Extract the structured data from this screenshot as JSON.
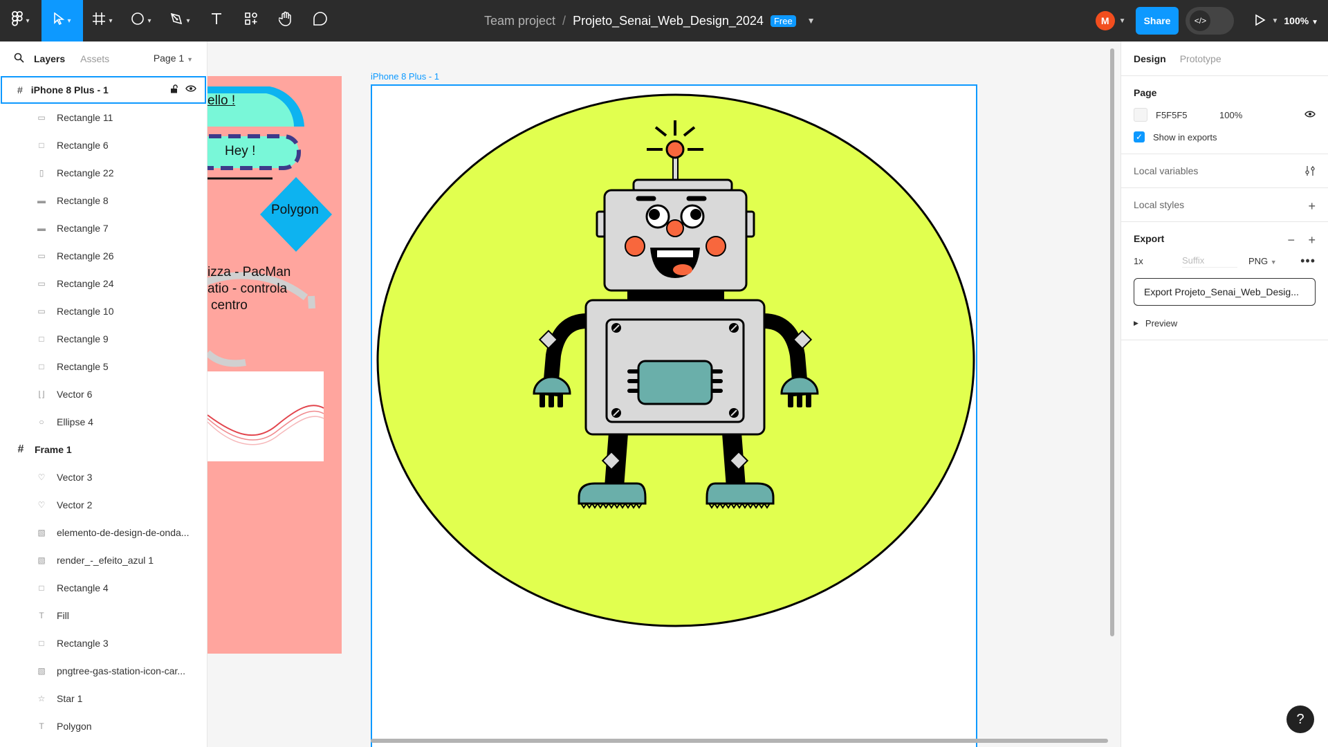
{
  "toolbar": {
    "team": "Team project",
    "file_name": "Projeto_Senai_Web_Design_2024",
    "plan_badge": "Free",
    "avatar_initial": "M",
    "share_label": "Share",
    "zoom": "100%"
  },
  "left_panel": {
    "tabs": [
      "Layers",
      "Assets"
    ],
    "page": "Page 1",
    "selected_frame": "iPhone 8 Plus - 1",
    "layers": [
      {
        "name": "Rectangle 11",
        "icon": "rect-icon"
      },
      {
        "name": "Rectangle 6",
        "icon": "rect-icon"
      },
      {
        "name": "Rectangle 22",
        "icon": "rect-icon"
      },
      {
        "name": "Rectangle 8",
        "icon": "rect-icon"
      },
      {
        "name": "Rectangle 7",
        "icon": "rect-icon"
      },
      {
        "name": "Rectangle 26",
        "icon": "rect-icon"
      },
      {
        "name": "Rectangle 24",
        "icon": "rect-icon"
      },
      {
        "name": "Rectangle 10",
        "icon": "rect-icon"
      },
      {
        "name": "Rectangle 9",
        "icon": "rect-icon"
      },
      {
        "name": "Rectangle 5",
        "icon": "rect-icon"
      },
      {
        "name": "Vector 6",
        "icon": "vector-icon"
      },
      {
        "name": "Ellipse 4",
        "icon": "ellipse-icon"
      }
    ],
    "frame2": "Frame 1",
    "frame2_layers": [
      {
        "name": "Vector 3",
        "icon": "heart-icon"
      },
      {
        "name": "Vector 2",
        "icon": "heart-icon"
      },
      {
        "name": "elemento-de-design-de-onda...",
        "icon": "image-icon"
      },
      {
        "name": "render_-_efeito_azul 1",
        "icon": "image-icon"
      },
      {
        "name": "Rectangle 4",
        "icon": "rect-icon"
      },
      {
        "name": "Fill",
        "icon": "text-icon"
      },
      {
        "name": "Rectangle 3",
        "icon": "rect-icon"
      },
      {
        "name": "pngtree-gas-station-icon-car...",
        "icon": "image-icon"
      },
      {
        "name": "Star 1",
        "icon": "star-icon"
      },
      {
        "name": "Polygon",
        "icon": "text-icon"
      }
    ]
  },
  "canvas": {
    "frame_label": "iPhone 8 Plus - 1",
    "pink_texts": {
      "hello": "ello !",
      "hey": "Hey !",
      "polygon": "Polygon",
      "line1": "izza - PacMan",
      "line2": "atio - controla",
      "line3": "centro"
    }
  },
  "right_panel": {
    "tabs": [
      "Design",
      "Prototype"
    ],
    "page_title": "Page",
    "page_color": "F5F5F5",
    "page_opacity": "100%",
    "show_in_exports": "Show in exports",
    "local_variables": "Local variables",
    "local_styles": "Local styles",
    "export_title": "Export",
    "export_scale": "1x",
    "export_suffix_placeholder": "Suffix",
    "export_format": "PNG",
    "export_button": "Export Projeto_Senai_Web_Desig...",
    "preview": "Preview"
  },
  "colors": {
    "accent": "#0D99FF",
    "toolbar_bg": "#2C2C2C",
    "robot_bg": "#E1FF4F",
    "pink": "#FFA59E",
    "teal": "#6AAFAA",
    "orange": "#F8673D"
  }
}
